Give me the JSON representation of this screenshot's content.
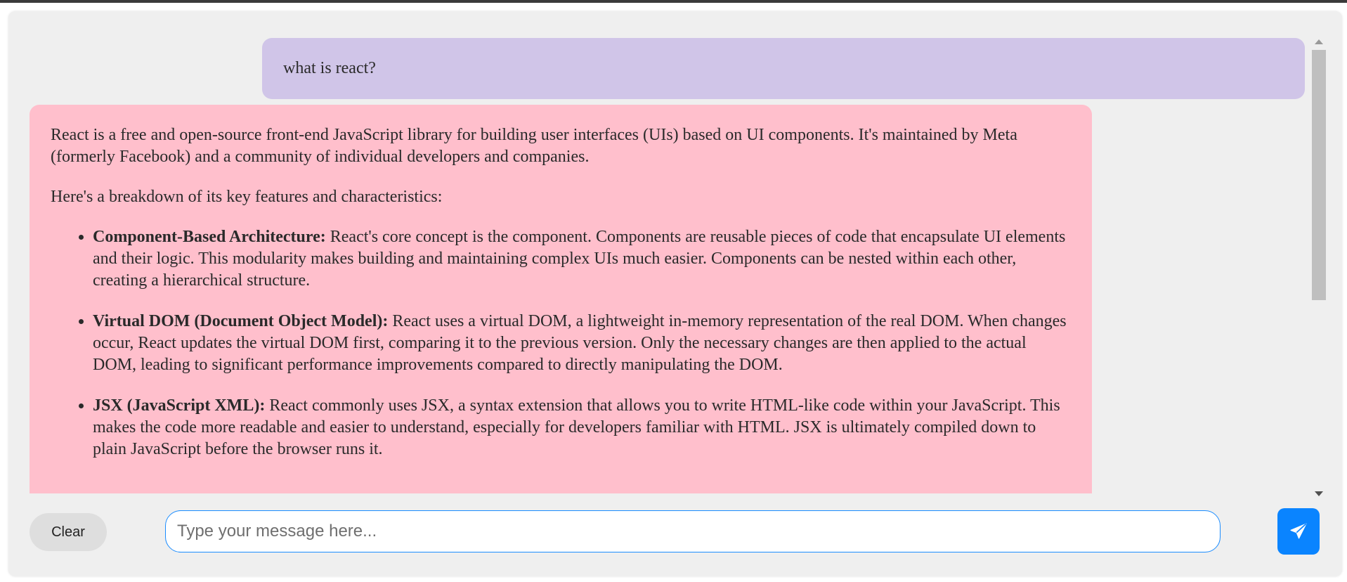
{
  "conversation": {
    "user_message": "what is react?",
    "bot_message": {
      "intro": "React is a free and open-source front-end JavaScript library for building user interfaces (UIs) based on UI components. It's maintained by Meta (formerly Facebook) and a community of individual developers and companies.",
      "lead": "Here's a breakdown of its key features and characteristics:",
      "features": [
        {
          "title": "Component-Based Architecture:",
          "text": " React's core concept is the component. Components are reusable pieces of code that encapsulate UI elements and their logic. This modularity makes building and maintaining complex UIs much easier. Components can be nested within each other, creating a hierarchical structure."
        },
        {
          "title": "Virtual DOM (Document Object Model):",
          "text": " React uses a virtual DOM, a lightweight in-memory representation of the real DOM. When changes occur, React updates the virtual DOM first, comparing it to the previous version. Only the necessary changes are then applied to the actual DOM, leading to significant performance improvements compared to directly manipulating the DOM."
        },
        {
          "title": "JSX (JavaScript XML):",
          "text": " React commonly uses JSX, a syntax extension that allows you to write HTML-like code within your JavaScript. This makes the code more readable and easier to understand, especially for developers familiar with HTML. JSX is ultimately compiled down to plain JavaScript before the browser runs it."
        }
      ]
    }
  },
  "composer": {
    "clear_label": "Clear",
    "input_value": "",
    "input_placeholder": "Type your message here...",
    "send_icon": "paper-plane-icon"
  },
  "colors": {
    "user_bubble": "#d0c5e8",
    "bot_bubble": "#ffbfcc",
    "send_button": "#0a84ff",
    "input_border": "#1a8cff"
  }
}
